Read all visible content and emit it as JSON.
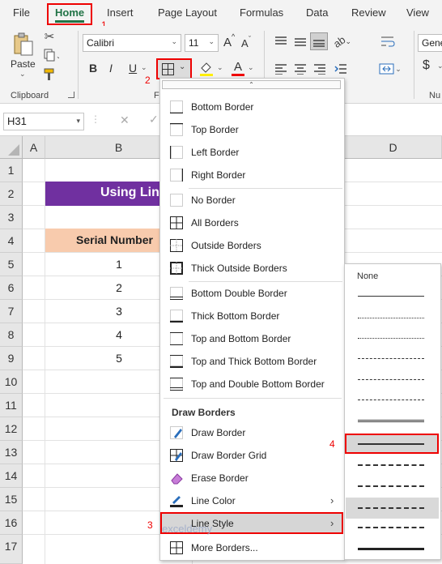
{
  "tabs": [
    "File",
    "Home",
    "Insert",
    "Page Layout",
    "Formulas",
    "Data",
    "Review",
    "View"
  ],
  "annotations": {
    "n1": "1",
    "n2": "2",
    "n3": "3",
    "n4": "4"
  },
  "ribbon": {
    "paste_label": "Paste",
    "clipboard_label": "Clipboard",
    "font_group_label": "F",
    "font_name": "Calibri",
    "font_size": "11",
    "bold": "B",
    "italic": "I",
    "underline": "U",
    "font_color_letter": "A",
    "grow_font": "A",
    "shrink_font": "A",
    "number_format": "Gene",
    "currency": "$",
    "number_group_label": "Nu"
  },
  "formula_bar": {
    "name_box": "H31",
    "cancel": "✕",
    "confirm": "✓"
  },
  "columns": [
    "A",
    "B",
    "D"
  ],
  "rows": [
    "1",
    "2",
    "3",
    "4",
    "5",
    "6",
    "7",
    "8",
    "9",
    "10",
    "11",
    "12",
    "13",
    "14",
    "15",
    "16",
    "17"
  ],
  "cells": {
    "title": "Using Lin",
    "header": "Serial Number",
    "values": [
      "1",
      "2",
      "3",
      "4",
      "5"
    ]
  },
  "border_menu": {
    "items": [
      "Bottom Border",
      "Top Border",
      "Left Border",
      "Right Border",
      "No Border",
      "All Borders",
      "Outside Borders",
      "Thick Outside Borders",
      "Bottom Double Border",
      "Thick Bottom Border",
      "Top and Bottom Border",
      "Top and Thick Bottom Border",
      "Top and Double Bottom Border"
    ],
    "draw_section": "Draw Borders",
    "draw_items": [
      "Draw Border",
      "Draw Border Grid",
      "Erase Border",
      "Line Color",
      "Line Style",
      "More Borders..."
    ]
  },
  "line_style_menu": {
    "none_label": "None"
  },
  "colors": {
    "title_fill": "#7030a0",
    "header_fill": "#f8cbad",
    "highlight_red": "#e00000",
    "home_underline": "#217346"
  },
  "watermark": "exceldemy"
}
